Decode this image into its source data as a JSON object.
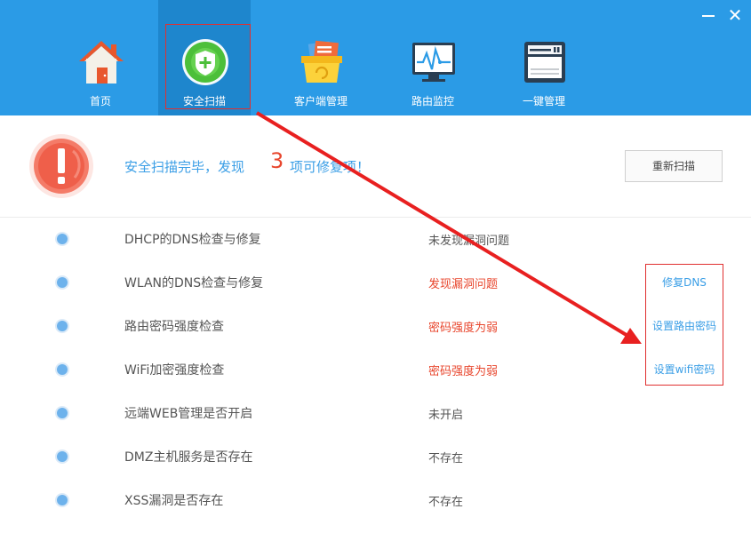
{
  "window": {
    "minimize_label": "—",
    "close_label": "✕"
  },
  "nav": {
    "items": [
      {
        "label": "首页",
        "icon": "home-icon"
      },
      {
        "label": "安全扫描",
        "icon": "shield-plus-icon",
        "active": true
      },
      {
        "label": "客户端管理",
        "icon": "folder-basket-icon"
      },
      {
        "label": "路由监控",
        "icon": "monitor-chart-icon"
      },
      {
        "label": "一键管理",
        "icon": "router-device-icon"
      }
    ]
  },
  "summary": {
    "text_before": "安全扫描完毕，发现",
    "issue_count": "3",
    "text_after": "项可修复项！",
    "rescan_label": "重新扫描"
  },
  "checks": [
    {
      "name": "DHCP的DNS检查与修复",
      "result": "未发现漏洞问题",
      "status": "ok",
      "action": ""
    },
    {
      "name": "WLAN的DNS检查与修复",
      "result": "发现漏洞问题",
      "status": "bad",
      "action": "修复DNS"
    },
    {
      "name": "路由密码强度检查",
      "result": "密码强度为弱",
      "status": "bad",
      "action": "设置路由密码"
    },
    {
      "name": "WiFi加密强度检查",
      "result": "密码强度为弱",
      "status": "bad",
      "action": "设置wifi密码"
    },
    {
      "name": "远端WEB管理是否开启",
      "result": "未开启",
      "status": "ok",
      "action": ""
    },
    {
      "name": "DMZ主机服务是否存在",
      "result": "不存在",
      "status": "ok",
      "action": ""
    },
    {
      "name": "XSS漏洞是否存在",
      "result": "不存在",
      "status": "ok",
      "action": ""
    }
  ],
  "colors": {
    "header": "#2b9be6",
    "accent": "#3a9ee6",
    "danger": "#e8462d",
    "annotation": "#e03030"
  }
}
